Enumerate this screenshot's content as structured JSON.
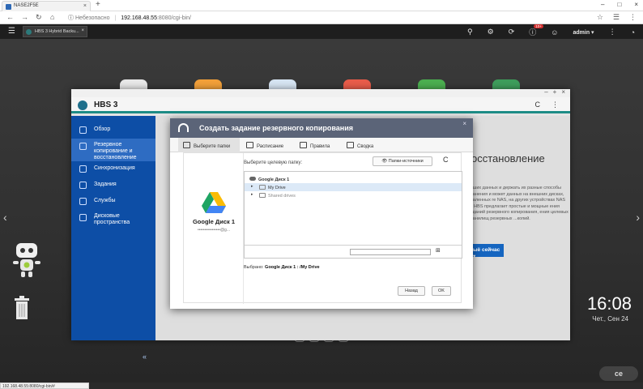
{
  "browser": {
    "tab_title": "NASE2F5E",
    "tab_close": "×",
    "new_tab": "+",
    "window_controls": [
      "–",
      "□",
      "×"
    ],
    "nav": {
      "back": "←",
      "forward": "→",
      "reload": "↻",
      "home": "⌂"
    },
    "address": {
      "security_label": "Небезопасно",
      "separator": "|",
      "host": "192.168.48.55",
      "path": ":8080/cgi-bin/"
    },
    "right_icons": {
      "star": "☆",
      "extensions": "☰",
      "menu": "⋮"
    },
    "status_url": "192.168.48.55:8080/cgi-bin/#"
  },
  "qts": {
    "menu_icon": "☰",
    "app_tab": {
      "label": "HBS 3 Hybrid Backu...",
      "close": "×"
    },
    "icons": {
      "search": "⚲",
      "tasks": "⚙",
      "updates": "⟳",
      "notifications": "ⓘ",
      "user": "☺",
      "dashboard": "◔"
    },
    "notification_badge": "10+",
    "user_label": "admin ▾",
    "more": "⋮"
  },
  "desktop": {
    "clock": "16:08",
    "date": "Чет., Сен 24",
    "arrow_left": "‹",
    "arrow_right": "›",
    "bottom_controls": [
      "◎",
      "⊕",
      "▣",
      "▣"
    ],
    "watermark": "ce"
  },
  "hbs": {
    "title": "HBS 3",
    "window_controls": [
      "–",
      "+",
      "×"
    ],
    "tools": {
      "refresh": "C",
      "more": "⋮"
    },
    "sidebar": [
      {
        "label": "Обзор"
      },
      {
        "label": "Резервное копирование и восстановление"
      },
      {
        "label": "Синхронизация"
      },
      {
        "label": "Задания"
      },
      {
        "label": "Службы"
      },
      {
        "label": "Дисковые пространства"
      }
    ],
    "collapse": "«",
    "background": {
      "heading": "осстановление",
      "text": "ваших данных и держать их разные способы хранения и может данных на внешних дисках, удаленных ге NAS, на других устройствах NAS ю, HBS предлагает простые и мощные ения заданий резервного копирования, ения целевых хранилищ резервных ...копий.",
      "button": "ыё сейчас ▾"
    }
  },
  "dialog": {
    "title": "Создать задание резервного копирования",
    "close": "×",
    "steps": [
      {
        "label": "Выберите папки"
      },
      {
        "label": "Расписание"
      },
      {
        "label": "Правила"
      },
      {
        "label": "Сводка"
      }
    ],
    "source": {
      "name": "Google Диск 1",
      "account": "••••••••••••••••@g..."
    },
    "destination": {
      "label": "Выберите целевую папку:",
      "source_folders_button": "Папки-источники",
      "refresh": "C",
      "tree": [
        {
          "label": "Google Диск 1"
        },
        {
          "label": "My Drive"
        },
        {
          "label": "Shared drives"
        }
      ],
      "path_value": "",
      "new_folder": "⊞",
      "selected_prefix": "Выбрано:",
      "selected_value": "Google Диск 1 : /My Drive"
    },
    "buttons": {
      "back": "Назад",
      "ok": "OK"
    }
  }
}
